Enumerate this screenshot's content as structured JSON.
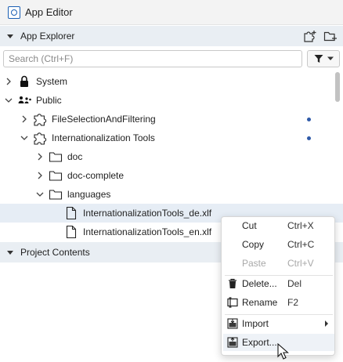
{
  "window": {
    "title": "App Editor",
    "icon": "app-editor-icon"
  },
  "app_explorer": {
    "header": "App Explorer",
    "search_placeholder": "Search (Ctrl+F)",
    "tree": [
      {
        "label": "System",
        "icon": "lock-icon",
        "expanded": false
      },
      {
        "label": "Public",
        "icon": "public-icon",
        "expanded": true
      },
      {
        "label": "FileSelectionAndFiltering",
        "icon": "puzzle-icon",
        "expanded": false,
        "dot": true
      },
      {
        "label": "Internationalization Tools",
        "icon": "puzzle-icon",
        "expanded": true,
        "dot": true
      },
      {
        "label": "doc",
        "icon": "folder-icon",
        "expanded": false
      },
      {
        "label": "doc-complete",
        "icon": "folder-icon",
        "expanded": false
      },
      {
        "label": "languages",
        "icon": "folder-icon",
        "expanded": true
      },
      {
        "label": "InternationalizationTools_de.xlf",
        "icon": "file-icon",
        "selected": true
      },
      {
        "label": "InternationalizationTools_en.xlf",
        "icon": "file-icon"
      }
    ]
  },
  "project_contents": {
    "header": "Project Contents"
  },
  "context_menu": {
    "items": [
      {
        "label": "Cut",
        "shortcut": "Ctrl+X"
      },
      {
        "label": "Copy",
        "shortcut": "Ctrl+C"
      },
      {
        "label": "Paste",
        "shortcut": "Ctrl+V",
        "disabled": true
      },
      {
        "label": "Delete...",
        "shortcut": "Del",
        "icon": "trash-icon"
      },
      {
        "label": "Rename",
        "shortcut": "F2",
        "icon": "rename-icon"
      },
      {
        "label": "Import",
        "icon": "import-icon",
        "submenu": true
      },
      {
        "label": "Export...",
        "icon": "export-icon",
        "hover": true
      }
    ]
  },
  "colors": {
    "accent": "#2f5aa8",
    "header_bg": "#e9eef3",
    "selected_bg": "#e6edf5"
  }
}
